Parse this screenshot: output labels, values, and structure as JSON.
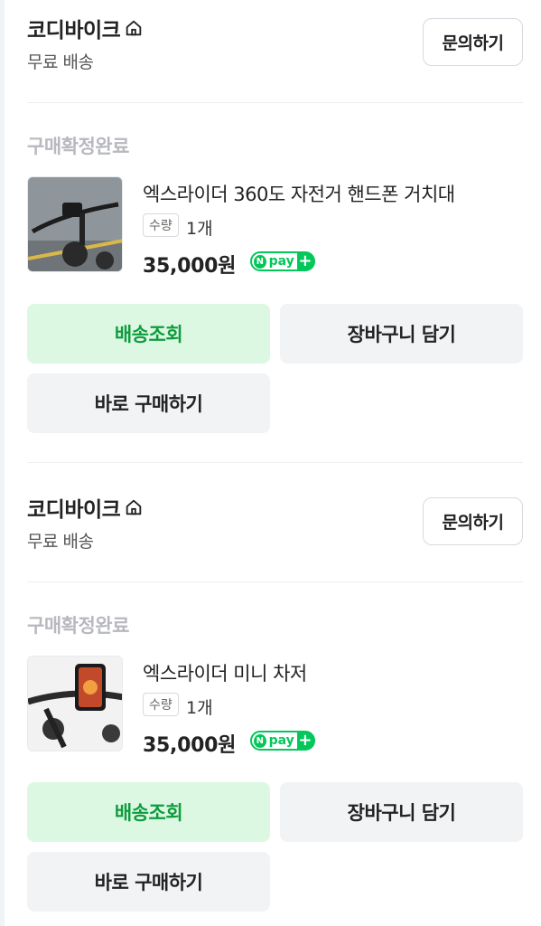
{
  "orders": [
    {
      "store": {
        "name": "코디바이크",
        "shipping": "무료 배송",
        "inquiry_label": "문의하기"
      },
      "status": "구매확정완료",
      "product": {
        "name": "엑스라이더 360도 자전거 핸드폰 거치대",
        "qty_label": "수량",
        "qty": "1개",
        "price": "35,000원",
        "pay_badge": "pay"
      },
      "buttons": {
        "track": "배송조회",
        "cart": "장바구니 담기",
        "buy": "바로 구매하기"
      }
    },
    {
      "store": {
        "name": "코디바이크",
        "shipping": "무료 배송",
        "inquiry_label": "문의하기"
      },
      "status": "구매확정완료",
      "product": {
        "name": "엑스라이더 미니 차저",
        "qty_label": "수량",
        "qty": "1개",
        "price": "35,000원",
        "pay_badge": "pay"
      },
      "buttons": {
        "track": "배송조회",
        "cart": "장바구니 담기",
        "buy": "바로 구매하기"
      }
    }
  ],
  "colors": {
    "accent_green": "#03c75a",
    "track_bg": "#dcf8e3",
    "track_text": "#0e9c3d"
  }
}
